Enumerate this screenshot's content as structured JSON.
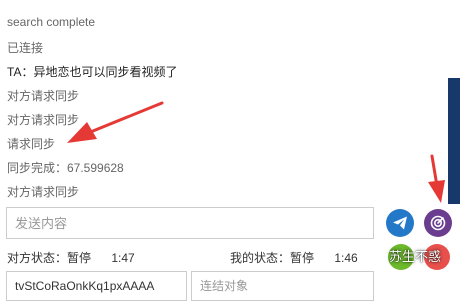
{
  "log": [
    {
      "text": "search complete"
    },
    {
      "text": "已连接"
    },
    {
      "text": "TA：异地恋也可以同步看视频了"
    },
    {
      "text": "对方请求同步"
    },
    {
      "text": "对方请求同步"
    },
    {
      "text": "请求同步"
    },
    {
      "text": "同步完成：67.599628"
    },
    {
      "text": "对方请求同步"
    }
  ],
  "composer": {
    "placeholder": "发送内容",
    "send_icon": "paper-plane-icon",
    "sync_icon": "sync-target-icon"
  },
  "status": {
    "peer_label": "对方状态：",
    "peer_state": "暂停",
    "peer_time": "1:47",
    "mine_label": "我的状态：",
    "mine_state": "暂停",
    "mine_time": "1:46"
  },
  "connection": {
    "room_id": "tvStCoRaOnkKq1pxAAAA",
    "target_placeholder": "连结对象"
  },
  "watermark": {
    "text": "苏生不惑"
  },
  "colors": {
    "send_button": "#2478c8",
    "sync_button": "#6a3d8f",
    "arrow": "#e53935",
    "scrollbar": "#17386b"
  }
}
